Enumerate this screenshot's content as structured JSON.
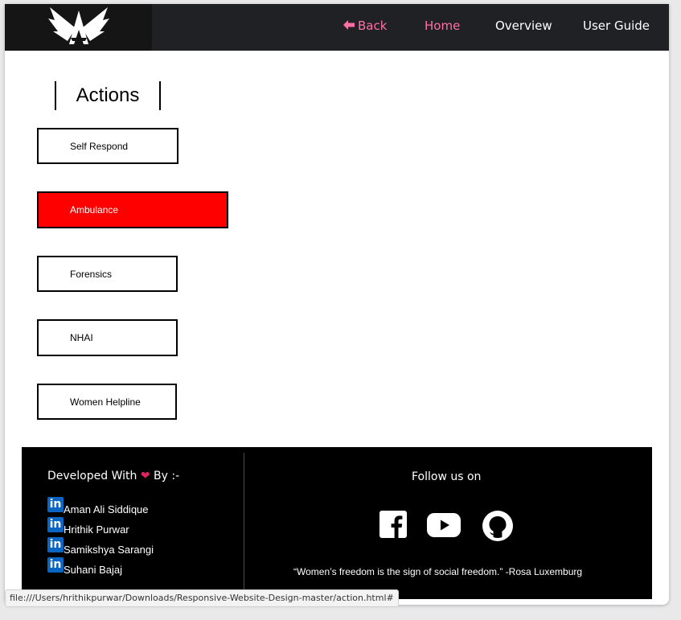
{
  "nav": {
    "back_label": "Back",
    "back_icon": "arrow-left-icon",
    "home_label": "Home",
    "overview_label": "Overview",
    "guide_label": "User Guide",
    "accent_color": "#ff6fa8"
  },
  "main": {
    "heading": "Actions",
    "buttons": [
      {
        "label": "Self Respond",
        "active": false
      },
      {
        "label": "Ambulance",
        "active": true
      },
      {
        "label": "Forensics",
        "active": false
      },
      {
        "label": "NHAI",
        "active": false
      },
      {
        "label": "Women Helpline",
        "active": false
      }
    ],
    "active_color": "#ff0000"
  },
  "footer": {
    "developed_prefix": "Developed With",
    "developed_suffix": "By :-",
    "heart_icon": "heart-icon",
    "linkedin_icon_text": "in",
    "developers": [
      "Aman Ali Siddique",
      "Hrithik Purwar",
      "Samikshya Sarangi",
      "Suhani Bajaj"
    ],
    "follow_label": "Follow us on",
    "social_icons": [
      "facebook-icon",
      "youtube-icon",
      "github-icon"
    ],
    "quote": "“Women’s freedom is the sign of social freedom.” -Rosa Luxemburg"
  },
  "status_bar": {
    "url": "file:///Users/hrithikpurwar/Downloads/Responsive-Website-Design-master/action.html#"
  }
}
